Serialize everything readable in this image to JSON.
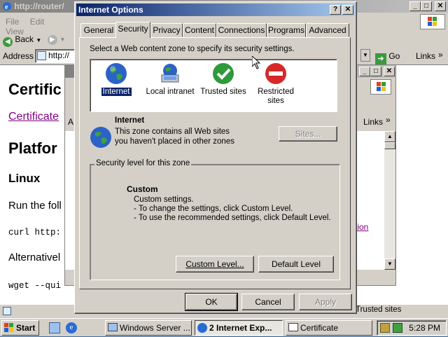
{
  "ie_main": {
    "title": "http://router/",
    "menu": [
      "File",
      "Edit",
      "View"
    ],
    "back_label": "Back",
    "address_label": "Address",
    "address_value": "http://",
    "go_label": "Go",
    "links_label": "Links"
  },
  "page_content": {
    "h1": "Certific",
    "link": "Certificate",
    "h2": "Platfor",
    "h3": "Linux",
    "para1": "Run the foll",
    "code1": "curl http:",
    "para2": "Alternativel",
    "code2": "wget --qui"
  },
  "ie_second": {
    "partial_a": "A",
    "links_label": "Links",
    "link_fragment": "tion",
    "status_zone": "Trusted sites"
  },
  "dialog": {
    "title": "Internet Options",
    "tabs": [
      "General",
      "Security",
      "Privacy",
      "Content",
      "Connections",
      "Programs",
      "Advanced"
    ],
    "active_tab": "Security",
    "instruction": "Select a Web content zone to specify its security settings.",
    "zones": [
      {
        "label": "Internet",
        "icon": "globe-icon"
      },
      {
        "label": "Local intranet",
        "icon": "intranet-icon"
      },
      {
        "label": "Trusted sites",
        "icon": "checkmark-icon"
      },
      {
        "label": "Restricted sites",
        "icon": "restricted-icon"
      }
    ],
    "selected_zone_name": "Internet",
    "selected_zone_desc": "This zone contains all Web sites you haven't placed in other zones",
    "sites_button": "Sites...",
    "security_group_label": "Security level for this zone",
    "level_name": "Custom",
    "level_lines": [
      "Custom settings.",
      "- To change the settings, click Custom Level.",
      "- To use the recommended settings, click Default Level."
    ],
    "custom_level_button": "Custom Level...",
    "default_level_button": "Default Level",
    "ok_button": "OK",
    "cancel_button": "Cancel",
    "apply_button": "Apply"
  },
  "taskbar": {
    "start_label": "Start",
    "tasks": [
      {
        "label": "Windows Server ...",
        "pressed": false
      },
      {
        "label": "2 Internet Exp...",
        "pressed": true
      },
      {
        "label": "Certificate",
        "pressed": false
      }
    ],
    "clock": "5:28 PM"
  }
}
